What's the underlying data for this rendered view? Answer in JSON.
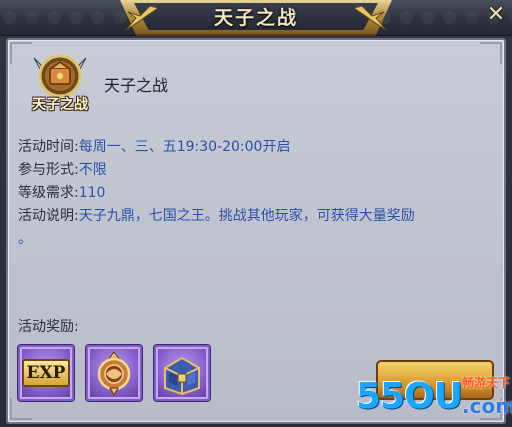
{
  "window": {
    "title": "天子之战",
    "close_symbol": "✕"
  },
  "event": {
    "badge_label": "天子之战",
    "name": "天子之战"
  },
  "info": {
    "time_label": "活动时间:",
    "time_value": "每周一、三、五19:30-20:00开启",
    "form_label": "参与形式:",
    "form_value": "不限",
    "level_label": "等级需求:",
    "level_value": "110",
    "desc_label": "活动说明:",
    "desc_value": "天子九鼎，七国之王。挑战其他玩家，可获得大量奖励",
    "desc_continuation": "。"
  },
  "rewards": {
    "label": "活动奖励:",
    "items": [
      {
        "icon": "exp-icon",
        "text": "EXP"
      },
      {
        "icon": "emblem-icon"
      },
      {
        "icon": "treasure-chest-icon"
      }
    ]
  },
  "watermark": {
    "main": "55OU",
    "com": ".com",
    "small": "畅游天下"
  },
  "colors": {
    "value_text": "#2d4fa8",
    "label_text": "#2a2f3d",
    "reward_slot": "#8a63cf",
    "title_gold": "#f3e7c3"
  }
}
